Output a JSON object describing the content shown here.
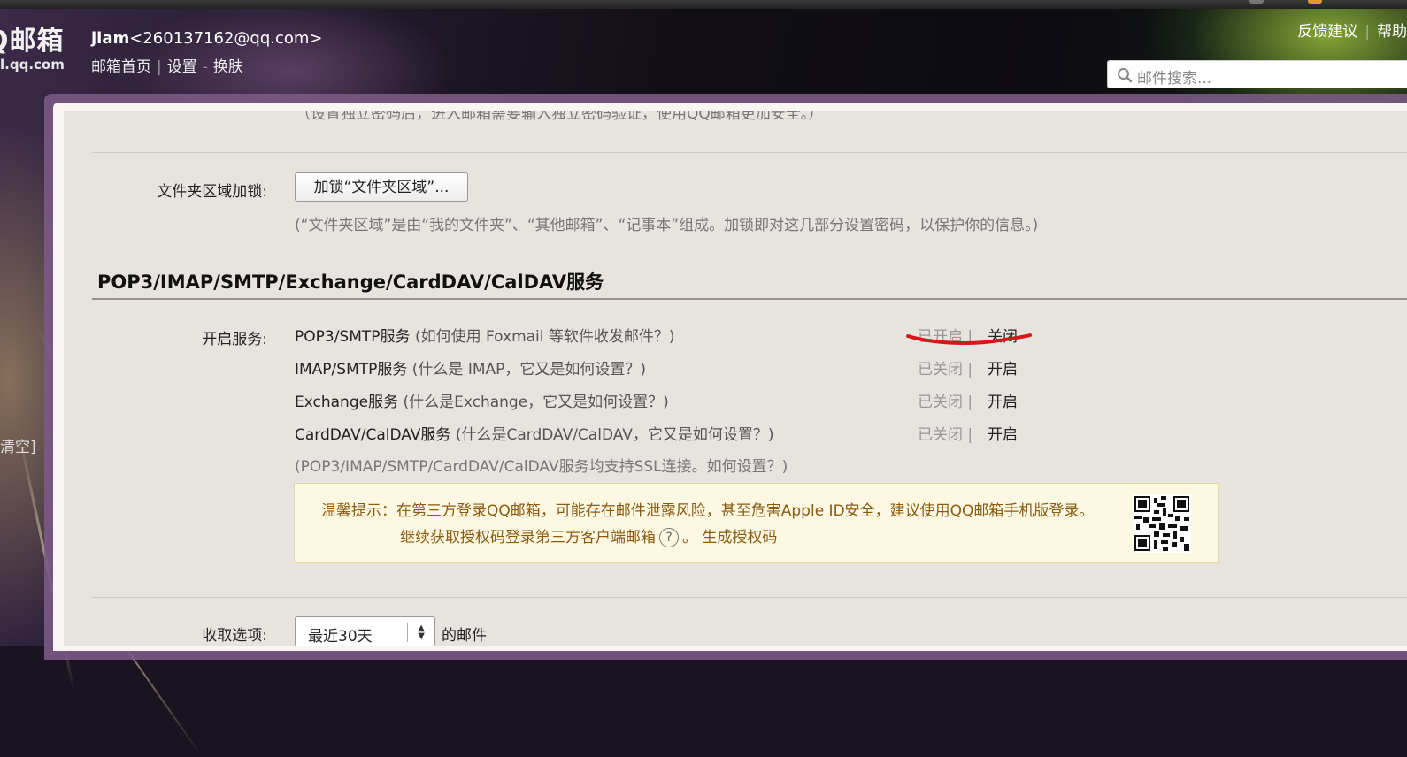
{
  "header": {
    "logo_line1": "Q邮箱",
    "logo_line2": "l.qq.com",
    "user_name": "jiam",
    "user_email": "<260137162@qq.com>",
    "link_home": "邮箱首页",
    "link_settings": "设置",
    "link_skin": "换肤",
    "link_feedback": "反馈建议",
    "link_help": "帮助",
    "search_placeholder": "邮件搜索..."
  },
  "sidebar": {
    "clipped_text": "清空]"
  },
  "content": {
    "cut_off_note": "（设置独立密码后，进入邮箱需要输入独立密码验证，使用QQ邮箱更加安全。）",
    "folder_lock": {
      "label": "文件夹区域加锁:",
      "button": "加锁“文件夹区域”...",
      "note": "(“文件夹区域”是由“我的文件夹”、“其他邮箱”、“记事本”组成。加锁即对这几部分设置密码，以保护你的信息。)"
    },
    "section_title": "POP3/IMAP/SMTP/Exchange/CardDAV/CalDAV服务",
    "services_label": "开启服务:",
    "services": [
      {
        "name": "POP3/SMTP服务",
        "help": "(如何使用 Foxmail 等软件收发邮件？)",
        "status": "已开启",
        "action": "关闭"
      },
      {
        "name": "IMAP/SMTP服务",
        "help": "(什么是 IMAP，它又是如何设置？)",
        "status": "已关闭",
        "action": "开启"
      },
      {
        "name": "Exchange服务",
        "help": "(什么是Exchange，它又是如何设置？)",
        "status": "已关闭",
        "action": "开启"
      },
      {
        "name": "CardDAV/CalDAV服务",
        "help": "(什么是CardDAV/CalDAV，它又是如何设置？)",
        "status": "已关闭",
        "action": "开启"
      }
    ],
    "ssl_note": "(POP3/IMAP/SMTP/CardDAV/CalDAV服务均支持SSL连接。如何设置？)",
    "tip": {
      "line1": "温馨提示：在第三方登录QQ邮箱，可能存在邮件泄露风险，甚至危害Apple ID安全，建议使用QQ邮箱手机版登录。",
      "line2_prefix": "继续获取授权码登录第三方客户端邮箱",
      "line2_help": "?",
      "line2_suffix": "。 生成授权码"
    },
    "fetch": {
      "label": "收取选项:",
      "select_value": "最近30天",
      "suffix": "的邮件"
    }
  },
  "colors": {
    "annotation_red": "#d9151b",
    "tip_text": "#8a5a10"
  }
}
